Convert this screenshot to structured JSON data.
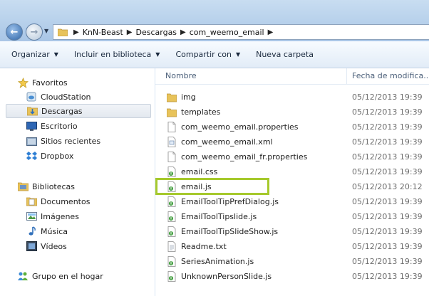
{
  "address": {
    "breadcrumbs": [
      "KnN-Beast",
      "Descargas",
      "com_weemo_email"
    ]
  },
  "toolbar": {
    "organize": "Organizar",
    "include": "Incluir en biblioteca",
    "share": "Compartir con",
    "new_folder": "Nueva carpeta"
  },
  "nav": {
    "favorites": "Favoritos",
    "cloudstation": "CloudStation",
    "downloads": "Descargas",
    "desktop": "Escritorio",
    "recent": "Sitios recientes",
    "dropbox": "Dropbox",
    "libraries": "Bibliotecas",
    "documents": "Documentos",
    "images": "Imágenes",
    "music": "Música",
    "videos": "Vídeos",
    "homegroup": "Grupo en el hogar"
  },
  "columns": {
    "name": "Nombre",
    "date": "Fecha de modifica..."
  },
  "files": [
    {
      "name": "img",
      "date": "05/12/2013 19:39",
      "icon": "folder-icon"
    },
    {
      "name": "templates",
      "date": "05/12/2013 19:39",
      "icon": "folder-icon"
    },
    {
      "name": "com_weemo_email.properties",
      "date": "05/12/2013 19:39",
      "icon": "document-icon"
    },
    {
      "name": "com_weemo_email.xml",
      "date": "05/12/2013 19:39",
      "icon": "xml-file-icon"
    },
    {
      "name": "com_weemo_email_fr.properties",
      "date": "05/12/2013 19:39",
      "icon": "document-icon"
    },
    {
      "name": "email.css",
      "date": "05/12/2013 19:39",
      "icon": "script-file-icon"
    },
    {
      "name": "email.js",
      "date": "05/12/2013 20:12",
      "icon": "script-file-icon"
    },
    {
      "name": "EmailToolTipPrefDialog.js",
      "date": "05/12/2013 19:39",
      "icon": "script-file-icon"
    },
    {
      "name": "EmailToolTipslide.js",
      "date": "05/12/2013 19:39",
      "icon": "script-file-icon"
    },
    {
      "name": "EmailToolTipSlideShow.js",
      "date": "05/12/2013 19:39",
      "icon": "script-file-icon"
    },
    {
      "name": "Readme.txt",
      "date": "05/12/2013 19:39",
      "icon": "text-file-icon"
    },
    {
      "name": "SeriesAnimation.js",
      "date": "05/12/2013 19:39",
      "icon": "script-file-icon"
    },
    {
      "name": "UnknownPersonSlide.js",
      "date": "05/12/2013 19:39",
      "icon": "script-file-icon"
    }
  ],
  "highlighted_file": "email.js",
  "colors": {
    "highlight": "#a6c92c",
    "folder": "#e8c35a",
    "toolbar_bg": "#e2ecf7"
  }
}
